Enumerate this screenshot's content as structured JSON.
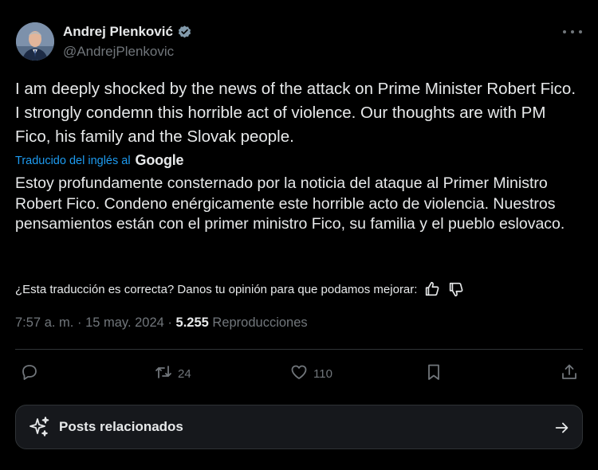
{
  "author": {
    "name": "Andrej Plenković",
    "handle": "@AndrejPlenkovic",
    "verified": true
  },
  "tweet": {
    "text": "I am deeply shocked by the news of the attack on Prime Minister Robert Fico. I strongly condemn this horrible act of violence. Our thoughts are with PM Fico, his family and the Slovak people."
  },
  "translation": {
    "label": "Traducido del inglés al",
    "provider": "Google",
    "text": "Estoy profundamente consternado por la noticia del ataque al Primer Ministro Robert Fico. Condeno enérgicamente este horrible acto de violencia. Nuestros pensamientos están con el primer ministro Fico, su familia y el pueblo eslovaco.",
    "feedback_prompt": "¿Esta traducción es correcta? Danos tu opinión para que podamos mejorar:"
  },
  "meta": {
    "time": "7:57 a. m.",
    "sep1": "·",
    "date": "15 may. 2024",
    "sep2": "·",
    "views": "5.255",
    "views_label": "Reproducciones"
  },
  "actions": {
    "reposts": "24",
    "likes": "110"
  },
  "related": {
    "label": "Posts relacionados"
  },
  "icons": {
    "more": "more-icon",
    "verified": "verified-badge-icon",
    "reply": "reply-icon",
    "repost": "repost-icon",
    "like": "heart-icon",
    "bookmark": "bookmark-icon",
    "share": "share-icon",
    "thumbs_up": "thumbs-up-icon",
    "thumbs_down": "thumbs-down-icon",
    "sparkle": "sparkle-icon",
    "arrow": "arrow-right-icon"
  },
  "colors": {
    "background": "#000000",
    "text": "#e7e9ea",
    "muted": "#71767b",
    "link": "#1d9bf0",
    "border": "#2f3336",
    "card": "#16181c"
  }
}
